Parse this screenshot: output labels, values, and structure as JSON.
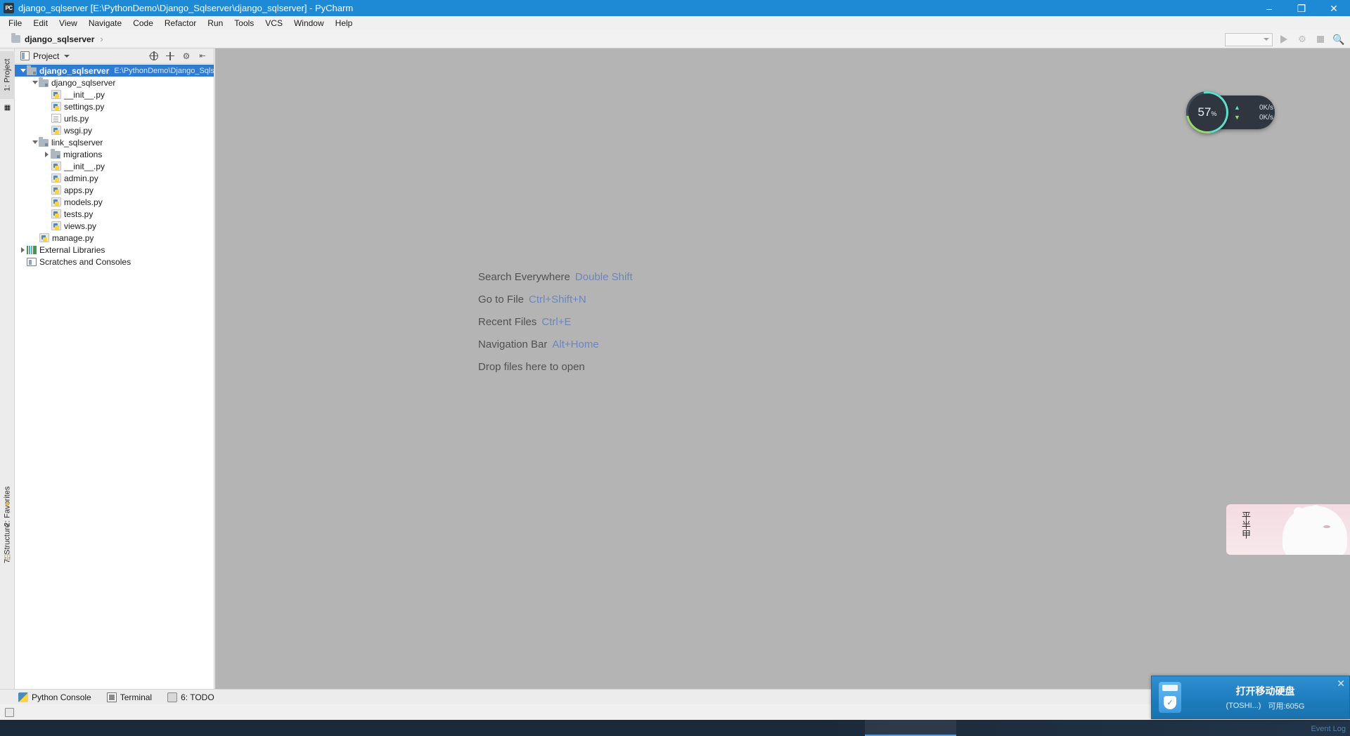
{
  "window": {
    "title": "django_sqlserver [E:\\PythonDemo\\Django_Sqlserver\\django_sqlserver] - PyCharm",
    "app_icon": "PC",
    "minimize": "–",
    "maximize": "❐",
    "close": "✕"
  },
  "menu": [
    {
      "label": "File"
    },
    {
      "label": "Edit"
    },
    {
      "label": "View"
    },
    {
      "label": "Navigate"
    },
    {
      "label": "Code"
    },
    {
      "label": "Refactor"
    },
    {
      "label": "Run"
    },
    {
      "label": "Tools"
    },
    {
      "label": "VCS"
    },
    {
      "label": "Window"
    },
    {
      "label": "Help"
    }
  ],
  "navbar": {
    "breadcrumb": "django_sqlserver",
    "separator": "›",
    "run_config_placeholder": "",
    "run_label": "Run",
    "debug_label": "Debug",
    "stop_label": "Stop",
    "search_label": "Search"
  },
  "rail": {
    "left_top": "1: Project",
    "left_bottom_1": "2: Favorites",
    "left_bottom_2": "7: Structure"
  },
  "project_panel": {
    "title": "Project",
    "tools": {
      "collapse": "Collapse All",
      "target": "Select Opened File",
      "settings": "Settings",
      "hide": "Hide"
    },
    "tree": [
      {
        "label": "django_sqlserver",
        "path": "E:\\PythonDemo\\Django_Sqlserver\\",
        "indent": 0,
        "twist": "down",
        "icon": "folder-src",
        "selected": true,
        "bold": true
      },
      {
        "label": "django_sqlserver",
        "path": "",
        "indent": 1,
        "twist": "down",
        "icon": "folder-src",
        "selected": false,
        "bold": false
      },
      {
        "label": "__init__.py",
        "path": "",
        "indent": 2,
        "twist": "none",
        "icon": "py",
        "selected": false,
        "bold": false
      },
      {
        "label": "settings.py",
        "path": "",
        "indent": 2,
        "twist": "none",
        "icon": "py",
        "selected": false,
        "bold": false
      },
      {
        "label": "urls.py",
        "path": "",
        "indent": 2,
        "twist": "none",
        "icon": "pyplain",
        "selected": false,
        "bold": false
      },
      {
        "label": "wsgi.py",
        "path": "",
        "indent": 2,
        "twist": "none",
        "icon": "py",
        "selected": false,
        "bold": false
      },
      {
        "label": "link_sqlserver",
        "path": "",
        "indent": 1,
        "twist": "down",
        "icon": "folder-src",
        "selected": false,
        "bold": false
      },
      {
        "label": "migrations",
        "path": "",
        "indent": 2,
        "twist": "right",
        "icon": "folder-src",
        "selected": false,
        "bold": false
      },
      {
        "label": "__init__.py",
        "path": "",
        "indent": 2,
        "twist": "none",
        "icon": "py",
        "selected": false,
        "bold": false
      },
      {
        "label": "admin.py",
        "path": "",
        "indent": 2,
        "twist": "none",
        "icon": "py",
        "selected": false,
        "bold": false
      },
      {
        "label": "apps.py",
        "path": "",
        "indent": 2,
        "twist": "none",
        "icon": "py",
        "selected": false,
        "bold": false
      },
      {
        "label": "models.py",
        "path": "",
        "indent": 2,
        "twist": "none",
        "icon": "py",
        "selected": false,
        "bold": false
      },
      {
        "label": "tests.py",
        "path": "",
        "indent": 2,
        "twist": "none",
        "icon": "py",
        "selected": false,
        "bold": false
      },
      {
        "label": "views.py",
        "path": "",
        "indent": 2,
        "twist": "none",
        "icon": "py",
        "selected": false,
        "bold": false
      },
      {
        "label": "manage.py",
        "path": "",
        "indent": 1,
        "twist": "none",
        "icon": "py",
        "selected": false,
        "bold": false
      },
      {
        "label": "External Libraries",
        "path": "",
        "indent": 0,
        "twist": "right",
        "icon": "lib",
        "selected": false,
        "bold": false
      },
      {
        "label": "Scratches and Consoles",
        "path": "",
        "indent": 0,
        "twist": "none",
        "icon": "scratch",
        "selected": false,
        "bold": false
      }
    ]
  },
  "editor": {
    "hints": [
      {
        "text": "Search Everywhere",
        "key": "Double Shift"
      },
      {
        "text": "Go to File",
        "key": "Ctrl+Shift+N"
      },
      {
        "text": "Recent Files",
        "key": "Ctrl+E"
      },
      {
        "text": "Navigation Bar",
        "key": "Alt+Home"
      },
      {
        "text": "Drop files here to open",
        "key": ""
      }
    ]
  },
  "bottom_tabs": [
    {
      "label": "Python Console",
      "icon": "python-icon"
    },
    {
      "label": "Terminal",
      "icon": "terminal-icon"
    },
    {
      "label": "6: TODO",
      "icon": "todo-icon"
    }
  ],
  "event_log": "Event Log",
  "net_widget": {
    "percent": "57",
    "percent_unit": "%",
    "upload": "0K/s",
    "download": "0K/s",
    "up_arrow": "▲",
    "down_arrow": "▼"
  },
  "mascot": {
    "text": "平半甲"
  },
  "notification": {
    "title": "打开移动硬盘",
    "device": "(TOSHI...)",
    "free_space": "可用:605G",
    "close": "✕",
    "shield": "✓"
  },
  "colors": {
    "titlebar": "#1e8ad6",
    "selection": "#2f7cd4",
    "editor_bg": "#b4b4b4",
    "hint_key": "#6a86c0",
    "notif_blue": "#1d7dbe"
  }
}
